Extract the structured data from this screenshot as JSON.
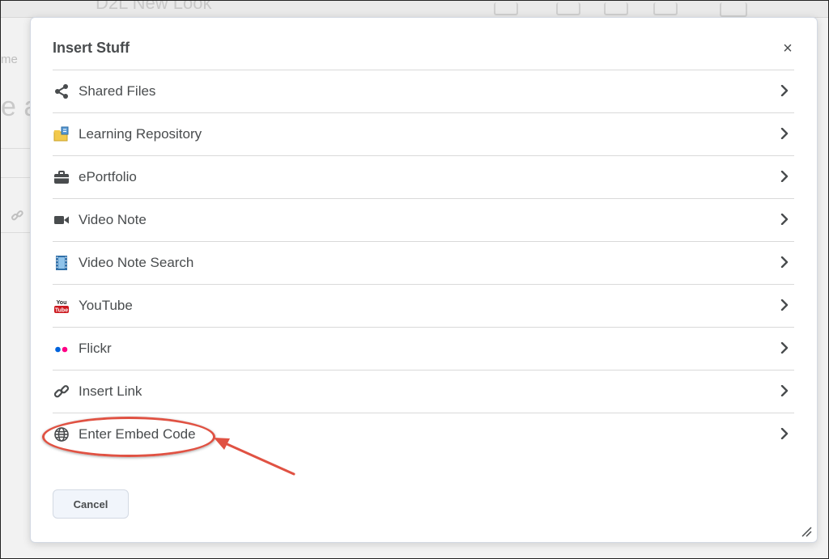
{
  "background": {
    "title_fragment": "D2L New Look",
    "breadcrumb_fragment": "me",
    "heading_fragment": "e a"
  },
  "dialog": {
    "title": "Insert Stuff",
    "close_symbol": "×",
    "items": [
      {
        "label": "Shared Files",
        "icon": "share-icon"
      },
      {
        "label": "Learning Repository",
        "icon": "repository-icon"
      },
      {
        "label": "ePortfolio",
        "icon": "briefcase-icon"
      },
      {
        "label": "Video Note",
        "icon": "video-camera-icon"
      },
      {
        "label": "Video Note Search",
        "icon": "film-icon"
      },
      {
        "label": "YouTube",
        "icon": "youtube-icon"
      },
      {
        "label": "Flickr",
        "icon": "flickr-icon"
      },
      {
        "label": "Insert Link",
        "icon": "link-icon"
      },
      {
        "label": "Enter Embed Code",
        "icon": "globe-icon"
      }
    ],
    "cancel_label": "Cancel"
  },
  "youtube_icon_text": {
    "top": "You",
    "bottom": "Tube"
  },
  "colors": {
    "text": "#494c4e",
    "annotation_red": "#e05243",
    "divider": "#d9d9d9",
    "flickr_blue": "#0063dc",
    "flickr_pink": "#ff0084",
    "youtube_red": "#cc181e"
  }
}
